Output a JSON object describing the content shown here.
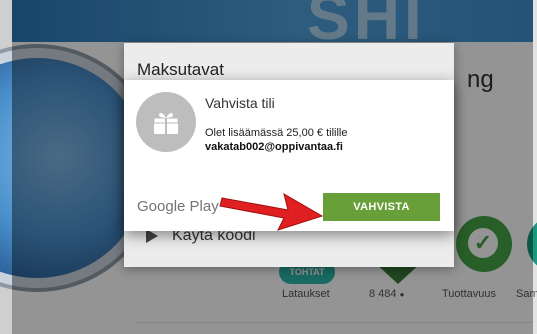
{
  "background_app": {
    "title_tail": "ng",
    "stats": {
      "badge_label": "TOHTAT",
      "downloads_label": "Lataukset",
      "reviews_count": "8 484",
      "reviews_icon": "person-icon",
      "productivity_label": "Tuottavuus",
      "similar_label": "Sam"
    }
  },
  "payment_panel": {
    "title": "Maksutavat",
    "redeem_label": "Käytä koodi"
  },
  "dialog": {
    "title": "Vahvista tili",
    "message": "Olet lisäämässä 25,00 € tilille",
    "email": "vakatab002@oppivantaa.fi",
    "brand": "Google Play",
    "confirm_label": "VAHVISTA",
    "icon": "gift-icon"
  },
  "colors": {
    "confirm_button": "#689f38",
    "annotation_arrow": "#e02020",
    "banner": "#3a8ccc"
  }
}
